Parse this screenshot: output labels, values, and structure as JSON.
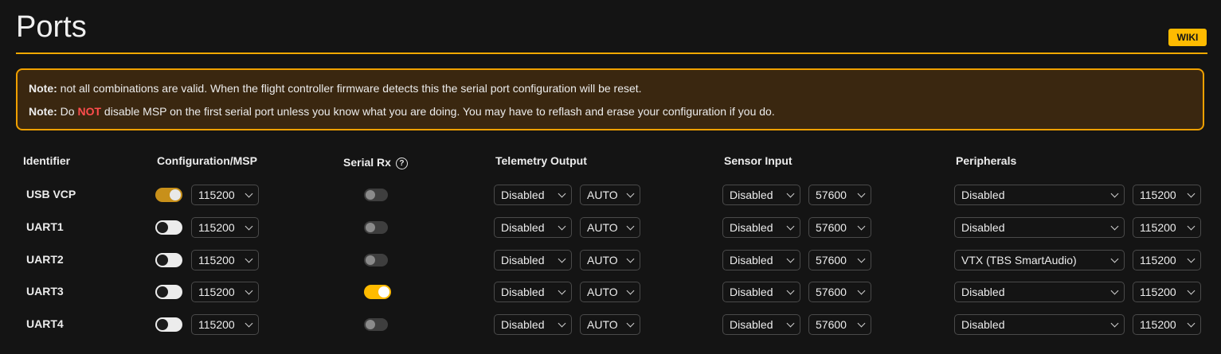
{
  "page": {
    "title": "Ports",
    "wiki_label": "WIKI"
  },
  "notes": [
    {
      "label": "Note:",
      "text_before": " not all combinations are valid. When the flight controller firmware detects this the serial port configuration will be reset.",
      "emphasis": "",
      "text_after": ""
    },
    {
      "label": "Note:",
      "text_before": " Do ",
      "emphasis": "NOT",
      "text_after": " disable MSP on the first serial port unless you know what you are doing. You may have to reflash and erase your configuration if you do."
    }
  ],
  "columns": {
    "identifier": "Identifier",
    "config_msp": "Configuration/MSP",
    "serial_rx": "Serial Rx",
    "serial_rx_help": "?",
    "telemetry": "Telemetry Output",
    "sensor": "Sensor Input",
    "peripherals": "Peripherals"
  },
  "ports": [
    {
      "id": "USB VCP",
      "msp_on": true,
      "msp_baud": "115200",
      "serial_rx_on": false,
      "telemetry": "Disabled",
      "telemetry_baud": "AUTO",
      "sensor": "Disabled",
      "sensor_baud": "57600",
      "peripheral": "Disabled",
      "peripheral_baud": "115200"
    },
    {
      "id": "UART1",
      "msp_on": false,
      "msp_baud": "115200",
      "serial_rx_on": false,
      "telemetry": "Disabled",
      "telemetry_baud": "AUTO",
      "sensor": "Disabled",
      "sensor_baud": "57600",
      "peripheral": "Disabled",
      "peripheral_baud": "115200"
    },
    {
      "id": "UART2",
      "msp_on": false,
      "msp_baud": "115200",
      "serial_rx_on": false,
      "telemetry": "Disabled",
      "telemetry_baud": "AUTO",
      "sensor": "Disabled",
      "sensor_baud": "57600",
      "peripheral": "VTX (TBS SmartAudio)",
      "peripheral_baud": "115200"
    },
    {
      "id": "UART3",
      "msp_on": false,
      "msp_baud": "115200",
      "serial_rx_on": true,
      "telemetry": "Disabled",
      "telemetry_baud": "AUTO",
      "sensor": "Disabled",
      "sensor_baud": "57600",
      "peripheral": "Disabled",
      "peripheral_baud": "115200"
    },
    {
      "id": "UART4",
      "msp_on": false,
      "msp_baud": "115200",
      "serial_rx_on": false,
      "telemetry": "Disabled",
      "telemetry_baud": "AUTO",
      "sensor": "Disabled",
      "sensor_baud": "57600",
      "peripheral": "Disabled",
      "peripheral_baud": "115200"
    }
  ]
}
